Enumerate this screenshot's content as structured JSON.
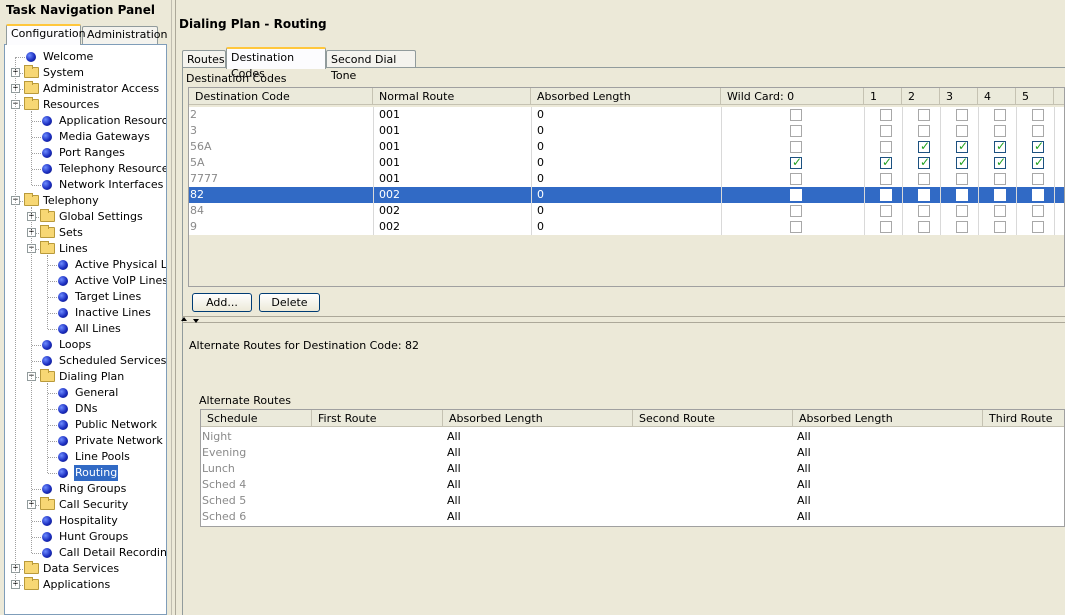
{
  "nav": {
    "title": "Task Navigation Panel",
    "tabs": [
      {
        "label": "Configuration",
        "active": true
      },
      {
        "label": "Administration",
        "active": false
      }
    ],
    "tree": [
      {
        "label": "Welcome",
        "type": "leaf",
        "depth": 0
      },
      {
        "label": "System",
        "type": "folder",
        "depth": 0,
        "expander": "+"
      },
      {
        "label": "Administrator Access",
        "type": "folder",
        "depth": 0,
        "expander": "+"
      },
      {
        "label": "Resources",
        "type": "folder",
        "depth": 0,
        "expander": "-"
      },
      {
        "label": "Application Resources",
        "type": "leaf",
        "depth": 1
      },
      {
        "label": "Media Gateways",
        "type": "leaf",
        "depth": 1
      },
      {
        "label": "Port Ranges",
        "type": "leaf",
        "depth": 1
      },
      {
        "label": "Telephony Resources",
        "type": "leaf",
        "depth": 1
      },
      {
        "label": "Network Interfaces",
        "type": "leaf",
        "depth": 1
      },
      {
        "label": "Telephony",
        "type": "folder",
        "depth": 0,
        "expander": "-"
      },
      {
        "label": "Global Settings",
        "type": "folder",
        "depth": 1,
        "expander": "+"
      },
      {
        "label": "Sets",
        "type": "folder",
        "depth": 1,
        "expander": "+"
      },
      {
        "label": "Lines",
        "type": "folder",
        "depth": 1,
        "expander": "-"
      },
      {
        "label": "Active Physical Lin",
        "type": "leaf",
        "depth": 2
      },
      {
        "label": "Active VoIP Lines",
        "type": "leaf",
        "depth": 2
      },
      {
        "label": "Target Lines",
        "type": "leaf",
        "depth": 2
      },
      {
        "label": "Inactive Lines",
        "type": "leaf",
        "depth": 2
      },
      {
        "label": "All Lines",
        "type": "leaf",
        "depth": 2
      },
      {
        "label": "Loops",
        "type": "leaf",
        "depth": 1
      },
      {
        "label": "Scheduled Services",
        "type": "leaf",
        "depth": 1
      },
      {
        "label": "Dialing Plan",
        "type": "folder",
        "depth": 1,
        "expander": "-"
      },
      {
        "label": "General",
        "type": "leaf",
        "depth": 2
      },
      {
        "label": "DNs",
        "type": "leaf",
        "depth": 2
      },
      {
        "label": "Public Network",
        "type": "leaf",
        "depth": 2
      },
      {
        "label": "Private Network",
        "type": "leaf",
        "depth": 2
      },
      {
        "label": "Line Pools",
        "type": "leaf",
        "depth": 2
      },
      {
        "label": "Routing",
        "type": "leaf",
        "depth": 2,
        "selected": true
      },
      {
        "label": "Ring Groups",
        "type": "leaf",
        "depth": 1
      },
      {
        "label": "Call Security",
        "type": "folder",
        "depth": 1,
        "expander": "+"
      },
      {
        "label": "Hospitality",
        "type": "leaf",
        "depth": 1
      },
      {
        "label": "Hunt Groups",
        "type": "leaf",
        "depth": 1
      },
      {
        "label": "Call Detail Recording",
        "type": "leaf",
        "depth": 1
      },
      {
        "label": "Data Services",
        "type": "folder",
        "depth": 0,
        "expander": "+"
      },
      {
        "label": "Applications",
        "type": "folder",
        "depth": 0,
        "expander": "+"
      }
    ]
  },
  "main": {
    "title": "Dialing Plan - Routing",
    "tabs": [
      {
        "label": "Routes",
        "active": false
      },
      {
        "label": "Destination Codes",
        "active": true
      },
      {
        "label": "Second Dial Tone",
        "active": false
      }
    ],
    "dest_group_label": "Destination Codes",
    "dest_table": {
      "columns": [
        "Destination Code",
        "Normal Route",
        "Absorbed Length",
        "Wild Card: 0",
        "1",
        "2",
        "3",
        "4",
        "5"
      ],
      "rows": [
        {
          "code": "2",
          "route": "001",
          "absorbed": "0",
          "wild": [
            false,
            false,
            false,
            false,
            false,
            false
          ]
        },
        {
          "code": "3",
          "route": "001",
          "absorbed": "0",
          "wild": [
            false,
            false,
            false,
            false,
            false,
            false
          ]
        },
        {
          "code": "56A",
          "route": "001",
          "absorbed": "0",
          "wild": [
            false,
            false,
            true,
            true,
            true,
            true
          ]
        },
        {
          "code": "5A",
          "route": "001",
          "absorbed": "0",
          "wild": [
            true,
            true,
            true,
            true,
            true,
            true
          ]
        },
        {
          "code": "7777",
          "route": "001",
          "absorbed": "0",
          "wild": [
            false,
            false,
            false,
            false,
            false,
            false
          ]
        },
        {
          "code": "82",
          "route": "002",
          "absorbed": "0",
          "wild": [
            false,
            false,
            false,
            false,
            false,
            false
          ],
          "selected": true
        },
        {
          "code": "84",
          "route": "002",
          "absorbed": "0",
          "wild": [
            false,
            false,
            false,
            false,
            false,
            false
          ]
        },
        {
          "code": "9",
          "route": "002",
          "absorbed": "0",
          "wild": [
            false,
            false,
            false,
            false,
            false,
            false
          ]
        }
      ]
    },
    "buttons": {
      "add": "Add...",
      "delete": "Delete"
    },
    "alt_heading": "Alternate Routes for Destination Code: 82",
    "alt_group_label": "Alternate Routes",
    "alt_table": {
      "columns": [
        "Schedule",
        "First Route",
        "Absorbed Length",
        "Second Route",
        "Absorbed Length",
        "Third Route"
      ],
      "rows": [
        {
          "schedule": "Night",
          "first": "",
          "abs1": "All",
          "second": "",
          "abs2": "All",
          "third": ""
        },
        {
          "schedule": "Evening",
          "first": "",
          "abs1": "All",
          "second": "",
          "abs2": "All",
          "third": ""
        },
        {
          "schedule": "Lunch",
          "first": "",
          "abs1": "All",
          "second": "",
          "abs2": "All",
          "third": ""
        },
        {
          "schedule": "Sched 4",
          "first": "",
          "abs1": "All",
          "second": "",
          "abs2": "All",
          "third": ""
        },
        {
          "schedule": "Sched 5",
          "first": "",
          "abs1": "All",
          "second": "",
          "abs2": "All",
          "third": ""
        },
        {
          "schedule": "Sched 6",
          "first": "",
          "abs1": "All",
          "second": "",
          "abs2": "All",
          "third": ""
        }
      ]
    }
  }
}
